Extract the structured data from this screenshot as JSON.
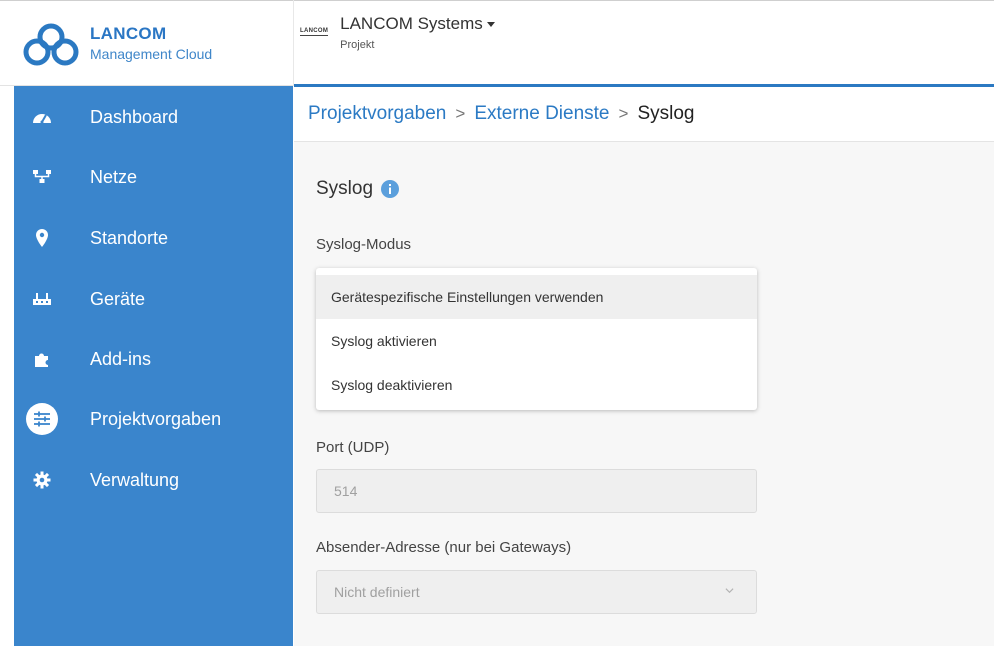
{
  "header": {
    "brand_title": "LANCOM",
    "brand_subtitle": "Management Cloud",
    "org_logo_text": "LANCOM",
    "org_name": "LANCOM Systems",
    "org_type": "Projekt"
  },
  "sidebar": {
    "items": [
      {
        "label": "Dashboard",
        "icon": "dashboard-icon"
      },
      {
        "label": "Netze",
        "icon": "network-icon"
      },
      {
        "label": "Standorte",
        "icon": "location-pin-icon"
      },
      {
        "label": "Geräte",
        "icon": "devices-icon"
      },
      {
        "label": "Add-ins",
        "icon": "puzzle-icon"
      },
      {
        "label": "Projektvorgaben",
        "icon": "sliders-icon",
        "active": true
      },
      {
        "label": "Verwaltung",
        "icon": "gear-icon"
      }
    ]
  },
  "breadcrumb": {
    "items": [
      "Projektvorgaben",
      "Externe Dienste",
      "Syslog"
    ],
    "separator": ">"
  },
  "main": {
    "title": "Syslog",
    "syslog_mode_label": "Syslog-Modus",
    "syslog_mode_options": [
      "Gerätespezifische Einstellungen verwenden",
      "Syslog aktivieren",
      "Syslog deaktivieren"
    ],
    "port_label": "Port (UDP)",
    "port_value": "514",
    "sender_label": "Absender-Adresse (nur bei Gateways)",
    "sender_value": "Nicht definiert"
  },
  "colors": {
    "sidebar_bg": "#3a85cc",
    "accent": "#2b7ac4",
    "info_icon": "#5b9fdc"
  }
}
